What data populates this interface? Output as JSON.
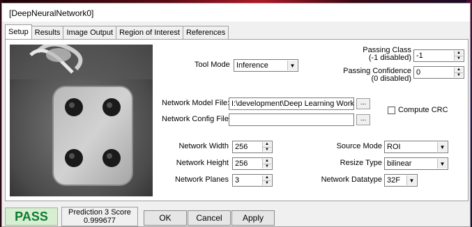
{
  "window": {
    "title": "[DeepNeuralNetwork0]"
  },
  "tabs": [
    {
      "label": "Setup",
      "active": true
    },
    {
      "label": "Results",
      "active": false
    },
    {
      "label": "Image Output",
      "active": false
    },
    {
      "label": "Region of Interest",
      "active": false
    },
    {
      "label": "References",
      "active": false
    }
  ],
  "tool_mode": {
    "label": "Tool Mode",
    "value": "Inference"
  },
  "passing_class": {
    "label_line1": "Passing Class",
    "label_line2": "(-1 disabled)",
    "value": "-1"
  },
  "passing_confidence": {
    "label_line1": "Passing Confidence",
    "label_line2": "(0 disabled)",
    "value": "0"
  },
  "model_file": {
    "label": "Network Model File:",
    "value": "I:\\development\\Deep Learning Work\\E"
  },
  "config_file": {
    "label": "Network Config File:",
    "value": ""
  },
  "browse_label": "...",
  "compute_crc": {
    "label": "Compute CRC",
    "checked": false
  },
  "network_width": {
    "label": "Network Width",
    "value": "256"
  },
  "network_height": {
    "label": "Network Height",
    "value": "256"
  },
  "network_planes": {
    "label": "Network Planes",
    "value": "3"
  },
  "source_mode": {
    "label": "Source Mode",
    "value": "ROI"
  },
  "resize_type": {
    "label": "Resize Type",
    "value": "bilinear"
  },
  "network_datatype": {
    "label": "Network Datatype",
    "value": "32F"
  },
  "status": {
    "result": "PASS",
    "result_color": "#0d7a2e",
    "prediction_label": "Prediction 3 Score",
    "prediction_value": "0.999677"
  },
  "buttons": {
    "ok": "OK",
    "cancel": "Cancel",
    "apply": "Apply"
  }
}
